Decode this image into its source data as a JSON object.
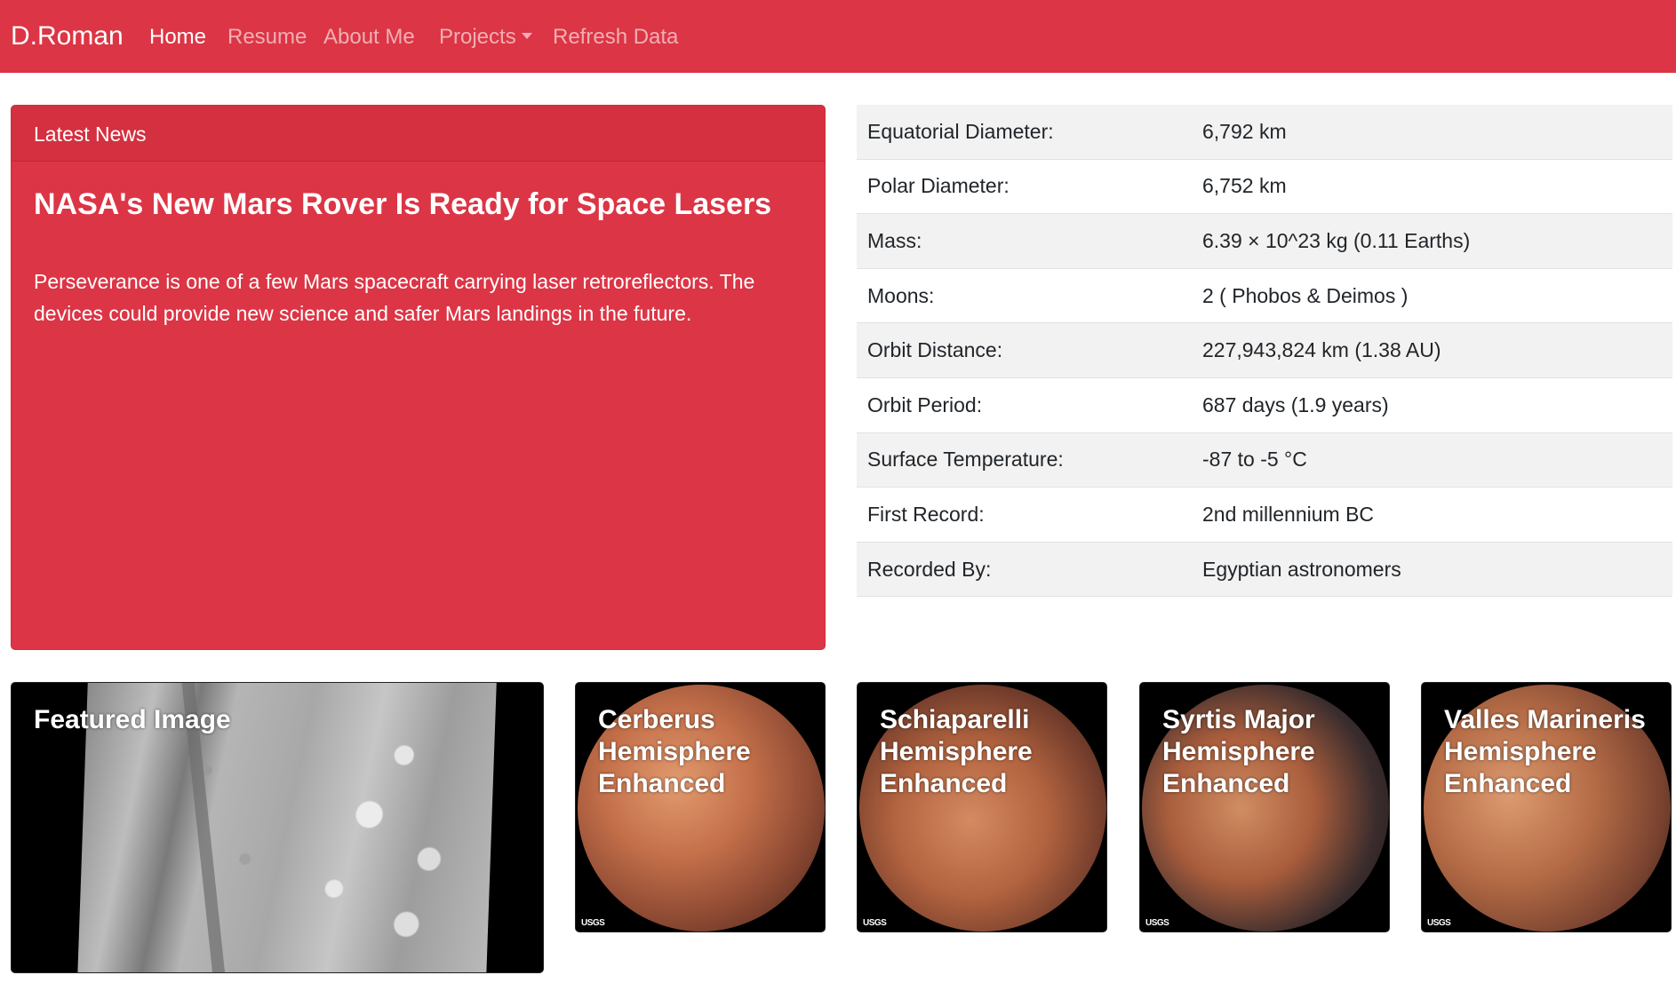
{
  "nav": {
    "brand": "D.Roman",
    "links": [
      "Home",
      "Resume",
      "About Me",
      "Projects",
      "Refresh Data"
    ]
  },
  "news": {
    "header": "Latest News",
    "title": "NASA's New Mars Rover Is Ready for Space Lasers",
    "body": "Perseverance is one of a few Mars spacecraft carrying laser retroreflectors. The devices could provide new science and safer Mars landings in the future."
  },
  "facts": [
    {
      "label": "Equatorial Diameter:",
      "value": "6,792 km"
    },
    {
      "label": "Polar Diameter:",
      "value": "6,752 km"
    },
    {
      "label": "Mass:",
      "value": "6.39 × 10^23 kg (0.11 Earths)"
    },
    {
      "label": "Moons:",
      "value": "2 ( Phobos & Deimos )"
    },
    {
      "label": "Orbit Distance:",
      "value": "227,943,824 km (1.38 AU)"
    },
    {
      "label": "Orbit Period:",
      "value": "687 days (1.9 years)"
    },
    {
      "label": "Surface Temperature:",
      "value": "-87 to -5 °C"
    },
    {
      "label": "First Record:",
      "value": "2nd millennium BC"
    },
    {
      "label": "Recorded By:",
      "value": "Egyptian astronomers"
    }
  ],
  "featured": {
    "title": "Featured Image"
  },
  "hemispheres": [
    {
      "line1": "Cerberus",
      "line2": "Hemisphere",
      "line3": "Enhanced"
    },
    {
      "line1": "Schiaparelli",
      "line2": "Hemisphere",
      "line3": "Enhanced"
    },
    {
      "line1": "Syrtis Major",
      "line2": "Hemisphere",
      "line3": "Enhanced"
    },
    {
      "line1": "Valles Marineris",
      "line2": "Hemisphere",
      "line3": "Enhanced"
    }
  ],
  "usgs_label": "USGS",
  "colors": {
    "navbar": "#dc3545",
    "news_card": "#dc3545"
  }
}
